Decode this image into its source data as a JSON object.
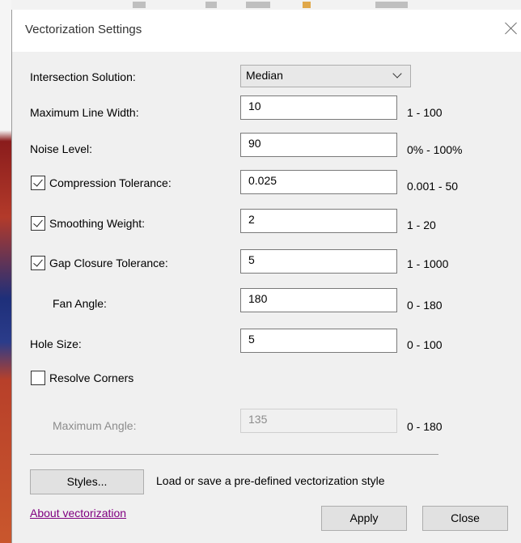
{
  "window": {
    "title": "Vectorization Settings"
  },
  "settings": {
    "intersection_solution": {
      "label": "Intersection Solution:",
      "selected": "Median"
    },
    "max_line_width": {
      "label": "Maximum Line Width:",
      "value": "10",
      "range": "1 - 100"
    },
    "noise_level": {
      "label": "Noise Level:",
      "value": "90",
      "range": "0% - 100%"
    },
    "compression_tolerance": {
      "label": "Compression Tolerance:",
      "value": "0.025",
      "range": "0.001 - 50",
      "checked": true
    },
    "smoothing_weight": {
      "label": "Smoothing Weight:",
      "value": "2",
      "range": "1 - 20",
      "checked": true
    },
    "gap_closure_tolerance": {
      "label": "Gap Closure Tolerance:",
      "value": "5",
      "range": "1 - 1000",
      "checked": true
    },
    "fan_angle": {
      "label": "Fan Angle:",
      "value": "180",
      "range": "0 - 180"
    },
    "hole_size": {
      "label": "Hole Size:",
      "value": "5",
      "range": "0 - 100"
    },
    "resolve_corners": {
      "label": "Resolve Corners",
      "checked": false
    },
    "maximum_angle": {
      "label": "Maximum Angle:",
      "value": "135",
      "range": "0 - 180",
      "disabled": true
    }
  },
  "styles": {
    "button_label": "Styles...",
    "description": "Load or save a pre-defined vectorization style"
  },
  "footer": {
    "about_link": "About vectorization",
    "apply_label": "Apply",
    "close_label": "Close"
  },
  "colors": {
    "link": "#800080",
    "dialog_bg": "#f0f0f0",
    "titlebar_bg": "#ffffff",
    "button_bg": "#e1e1e1"
  },
  "icons": {
    "close": "close-icon",
    "dropdown": "chevron-down-icon",
    "checkbox": "checkmark-icon"
  }
}
